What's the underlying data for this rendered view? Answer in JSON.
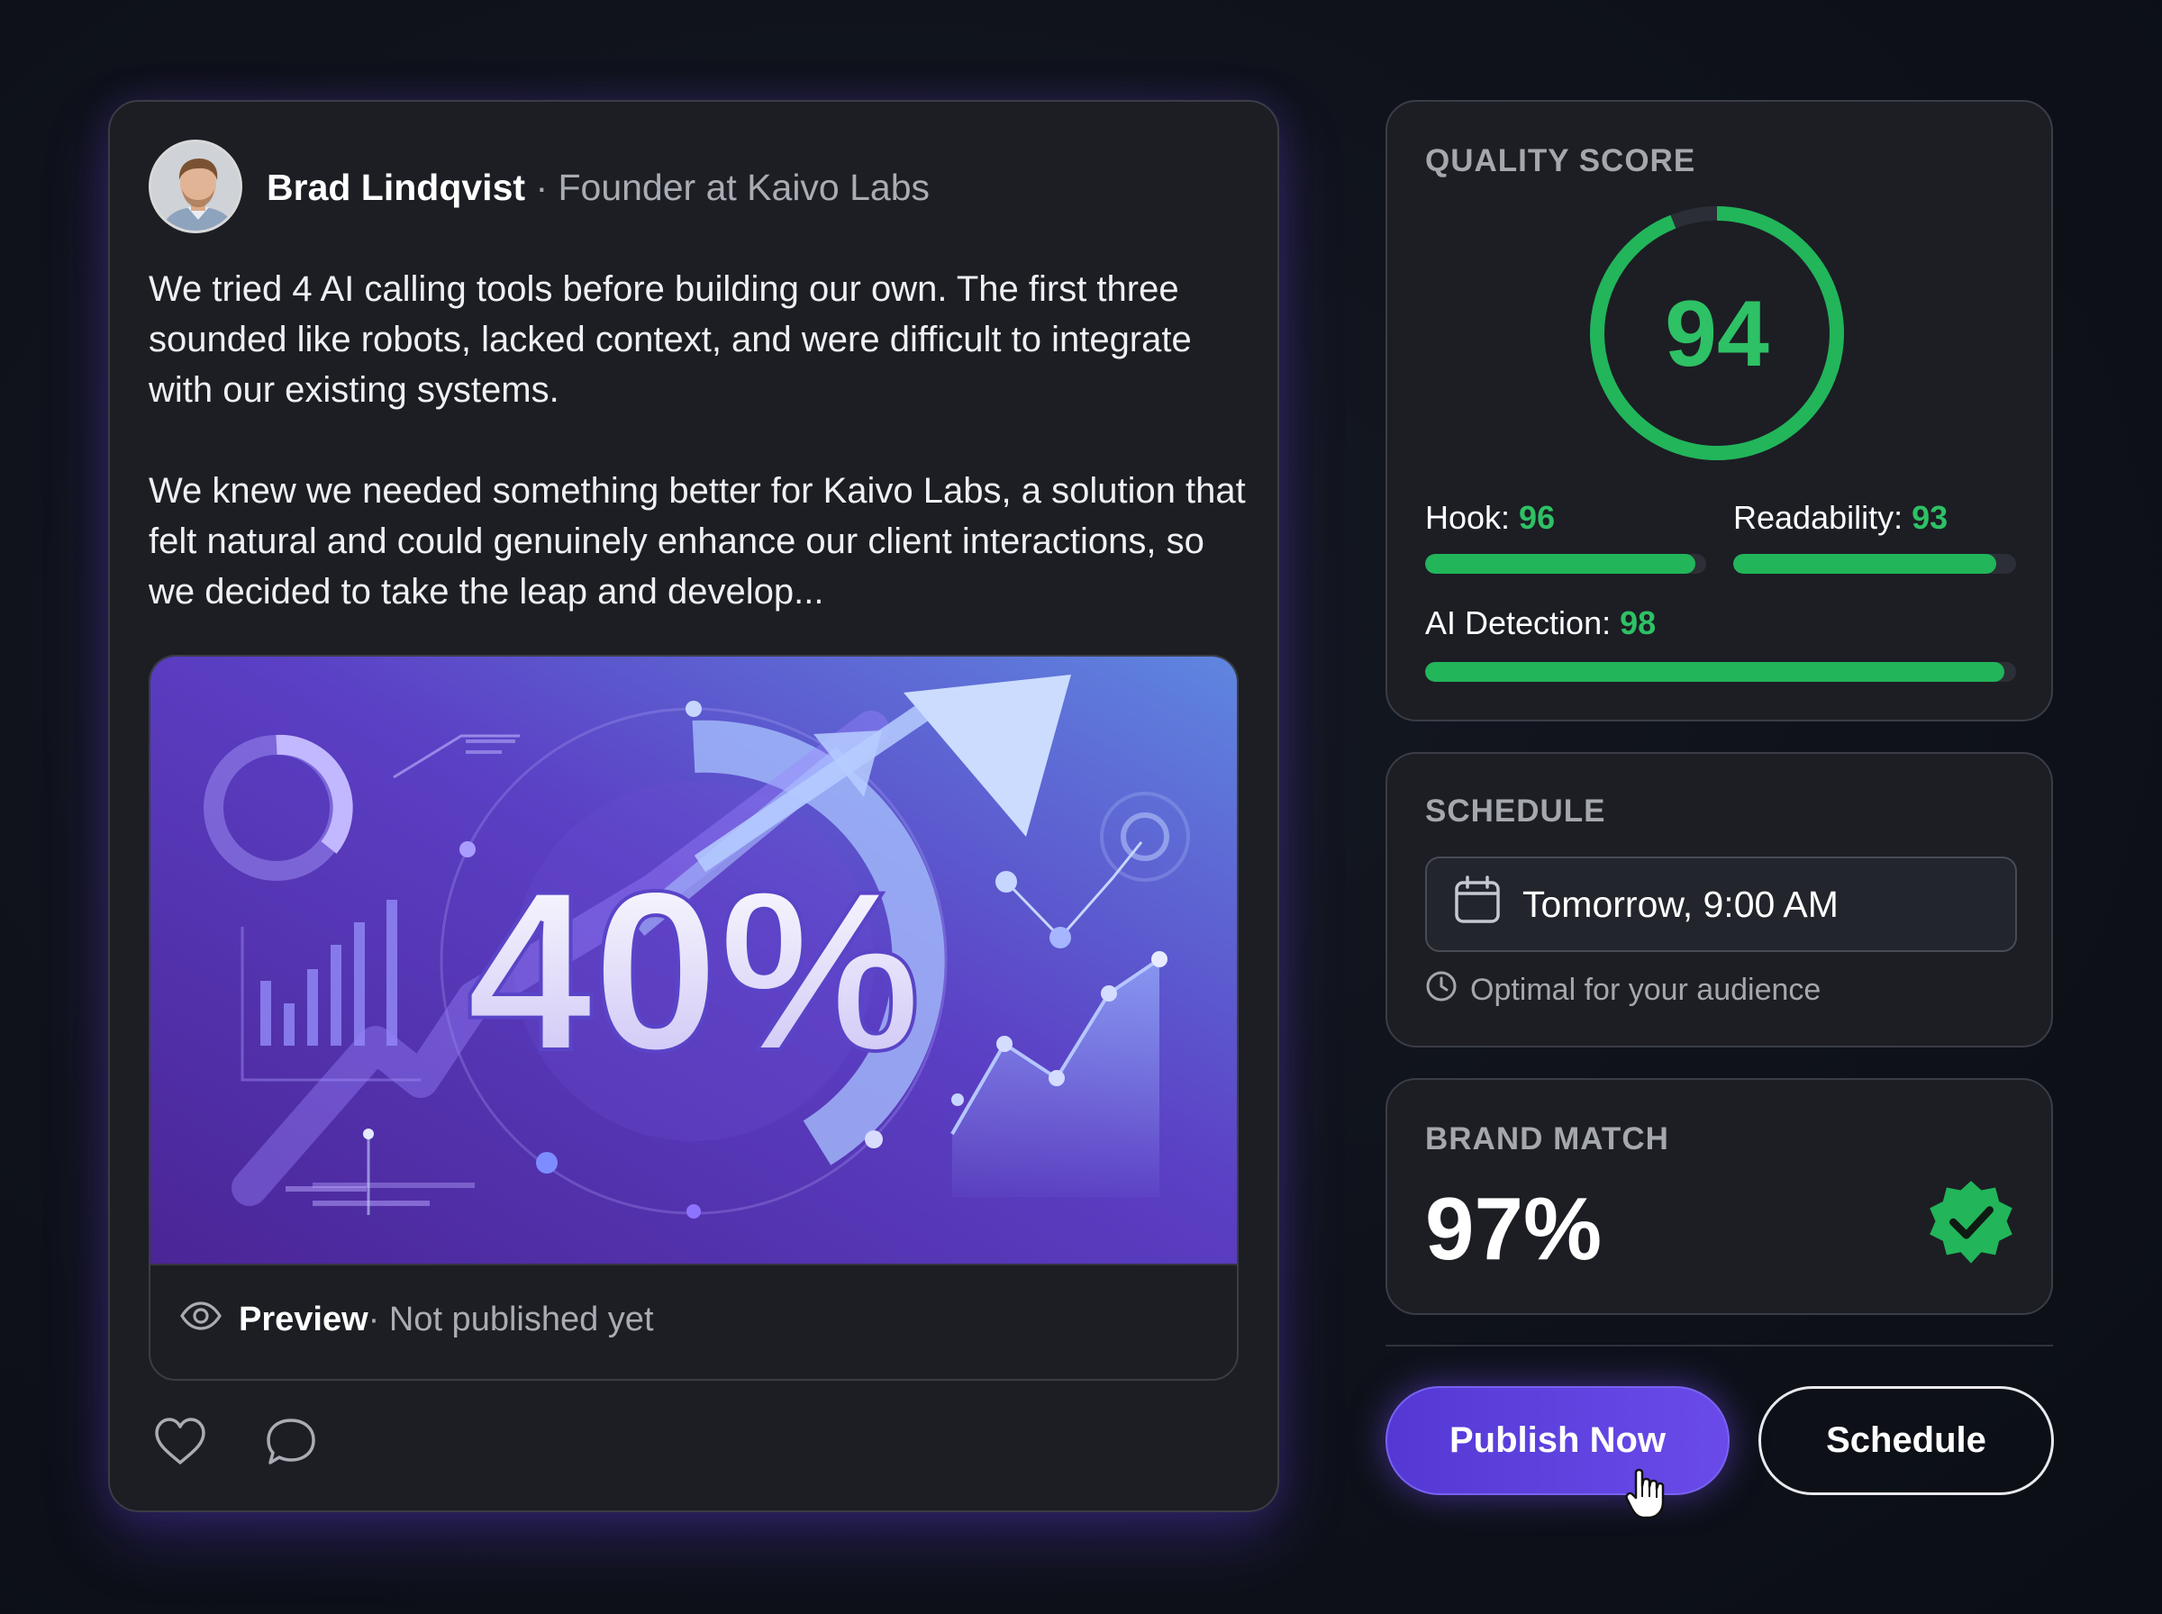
{
  "post": {
    "author_name": "Brad Lindqvist",
    "author_role": "· Founder at Kaivo Labs",
    "paragraphs": [
      "We tried 4 AI calling tools before building our own. The first three sounded like robots, lacked context, and were difficult to integrate with our existing systems.",
      "We knew we needed something better for Kaivo Labs, a solution that felt natural and could genuinely enhance our client interactions, so we decided to take the leap and develop..."
    ],
    "image_stat": "40%",
    "preview_label": "Preview",
    "preview_status": " · Not published yet",
    "icons": [
      "eye-icon",
      "heart-icon",
      "comment-icon"
    ]
  },
  "quality": {
    "title": "QUALITY SCORE",
    "score": "94",
    "score_value": 94,
    "metrics": {
      "hook": {
        "label": "Hook: ",
        "value": "96",
        "level": 96
      },
      "readability": {
        "label": "Readability: ",
        "value": "93",
        "level": 93
      },
      "ai_detection": {
        "label": "AI Detection: ",
        "value": "98",
        "level": 98
      }
    },
    "accent_color": "#2ec165"
  },
  "schedule": {
    "title": "SCHEDULE",
    "datetime": "Tomorrow, 9:00 AM",
    "hint": "Optimal for your audience",
    "icons": [
      "calendar-icon",
      "clock-icon"
    ]
  },
  "brand": {
    "title": "BRAND MATCH",
    "value": "97%",
    "badge_icon": "verified-badge-icon",
    "badge_color": "#22b55a"
  },
  "actions": {
    "publish_label": "Publish Now",
    "schedule_label": "Schedule",
    "publish_color": "#5b3fdc"
  }
}
